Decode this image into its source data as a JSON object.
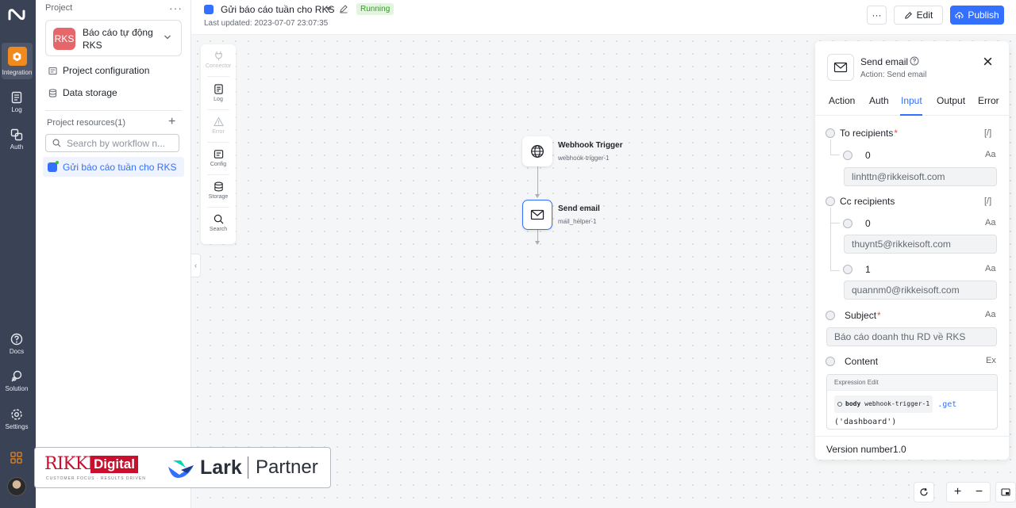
{
  "rail": {
    "items": [
      {
        "label": "Integration",
        "icon": "integration-icon"
      },
      {
        "label": "Log",
        "icon": "log-icon"
      },
      {
        "label": "Auth",
        "icon": "auth-icon"
      },
      {
        "label": "Docs",
        "icon": "docs-icon"
      },
      {
        "label": "Solution",
        "icon": "solution-icon"
      },
      {
        "label": "Settings",
        "icon": "settings-icon"
      }
    ]
  },
  "sidebar": {
    "project_label": "Project",
    "project_badge": "RKS",
    "project_name": "Báo cáo tự động RKS",
    "links": [
      "Project configuration",
      "Data storage"
    ],
    "resources_label": "Project resources(1)",
    "search_placeholder": "Search by workflow n...",
    "workflows": [
      "Gửi báo cáo tuần cho RKS"
    ]
  },
  "banner": {
    "rikkei_text": "RIKKEI",
    "digital_text": "Digital",
    "tagline": "CUSTOMER FOCUS - RESULTS DRIVEN",
    "lark_text": "Lark",
    "partner_text": "Partner"
  },
  "header": {
    "title": "Gửi báo cáo tuần cho RKS",
    "status": "Running",
    "last_updated": "Last updated: 2023-07-07 23:07:35",
    "more_label": "···",
    "edit_label": "Edit",
    "publish_label": "Publish"
  },
  "toolbox": {
    "items": [
      {
        "label": "Connector",
        "disabled": true
      },
      {
        "label": "Log",
        "disabled": false
      },
      {
        "label": "Error",
        "disabled": true
      },
      {
        "label": "Config",
        "disabled": false
      },
      {
        "label": "Storage",
        "disabled": false
      },
      {
        "label": "Search",
        "disabled": false
      }
    ]
  },
  "nodes": [
    {
      "title": "Webhook Trigger",
      "subtitle": "webhook-trigger-1",
      "icon": "globe-icon"
    },
    {
      "title": "Send email",
      "subtitle": "mail_helper-1",
      "icon": "mail-icon"
    }
  ],
  "panel": {
    "title": "Send email",
    "subtitle": "Action: Send email",
    "tabs": [
      "Action",
      "Auth",
      "Input",
      "Output",
      "Error"
    ],
    "active_tab": "Input",
    "to_label": "To recipients",
    "to_items": [
      {
        "index": "0",
        "value": "linhttn@rikkeisoft.com"
      }
    ],
    "cc_label": "Cc recipients",
    "cc_items": [
      {
        "index": "0",
        "value": "thuynt5@rikkeisoft.com"
      },
      {
        "index": "1",
        "value": "quannm0@rikkeisoft.com"
      }
    ],
    "subject_label": "Subject",
    "subject_value": "Báo cáo doanh thu RD về RKS",
    "content_label": "Content",
    "content_type": "Ex",
    "array_type": "[/]",
    "text_type": "Aa",
    "required_mark": "*",
    "expr_title": "Expression Edit",
    "expr_chip_key": "body",
    "expr_chip_source": "webhook-trigger-1",
    "expr_method": ".get",
    "expr_args": "('dashboard')",
    "version": "Version number1.0"
  },
  "colors": {
    "primary": "#3370ff",
    "rail_bg": "#3a4256",
    "running_green": "#2ea121",
    "integration_orange": "#f08a1f"
  }
}
